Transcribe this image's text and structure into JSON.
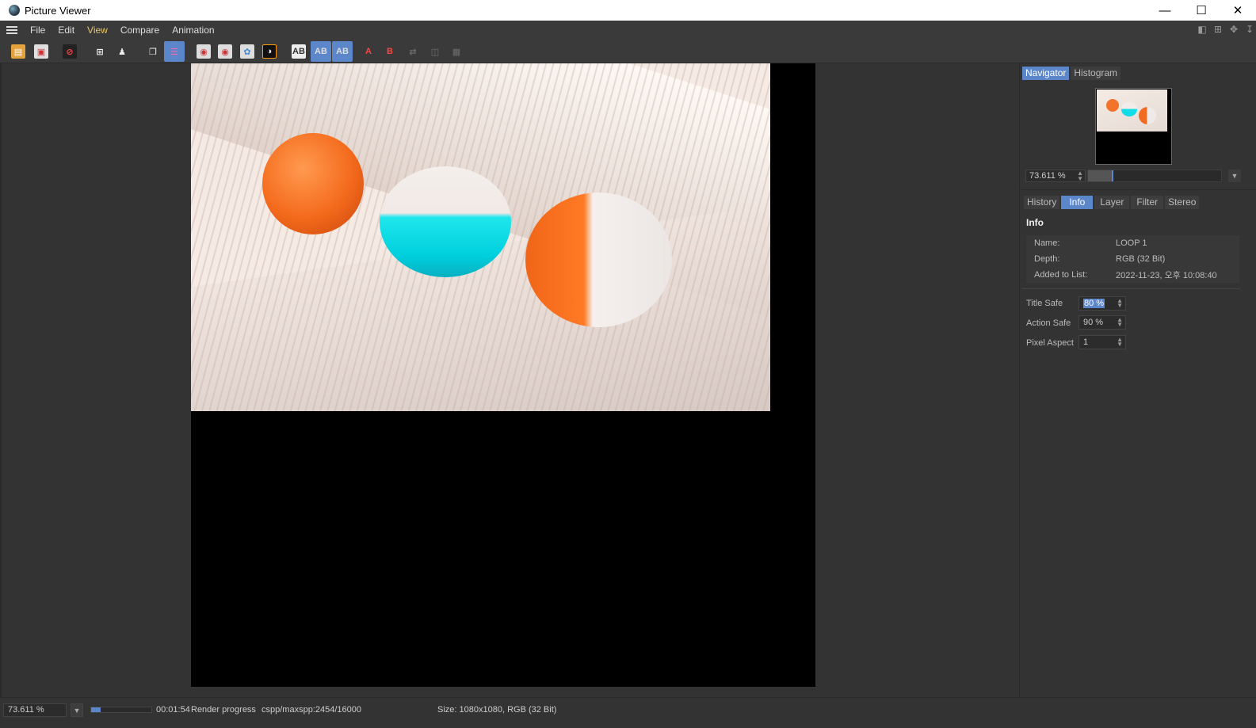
{
  "window": {
    "title": "Picture Viewer",
    "controls": [
      "minimize-icon",
      "maximize-icon",
      "close-icon"
    ]
  },
  "menu": {
    "items": [
      "File",
      "Edit",
      "View",
      "Compare",
      "Animation"
    ],
    "active": "View"
  },
  "navigator": {
    "tabs": [
      "Navigator",
      "Histogram"
    ],
    "active_tab": "Navigator",
    "zoom": "73.611 %",
    "zoom_percent": 73.611
  },
  "info_panel": {
    "tabs": [
      "History",
      "Info",
      "Layer",
      "Filter",
      "Stereo"
    ],
    "active_tab": "Info",
    "section_title": "Info",
    "rows": [
      {
        "key": "Name:",
        "value": "LOOP 1"
      },
      {
        "key": "Depth:",
        "value": "RGB (32 Bit)"
      },
      {
        "key": "Added to List:",
        "value": "2022-11-23, 오후 10:08:40"
      }
    ],
    "fields": [
      {
        "label": "Title Safe",
        "value": "80 %"
      },
      {
        "label": "Action Safe",
        "value": "90 %"
      },
      {
        "label": "Pixel Aspect",
        "value": "1"
      }
    ]
  },
  "status": {
    "zoom": "73.611 %",
    "progress_fraction": 0.153,
    "time": "00:01:54",
    "label": "Render progress",
    "spp": "cspp/maxspp:2454/16000",
    "size": "Size: 1080x1080, RGB (32 Bit)"
  },
  "colors": {
    "accent": "#5b86c9",
    "background": "#333333",
    "menu_active": "#e9c46a"
  }
}
